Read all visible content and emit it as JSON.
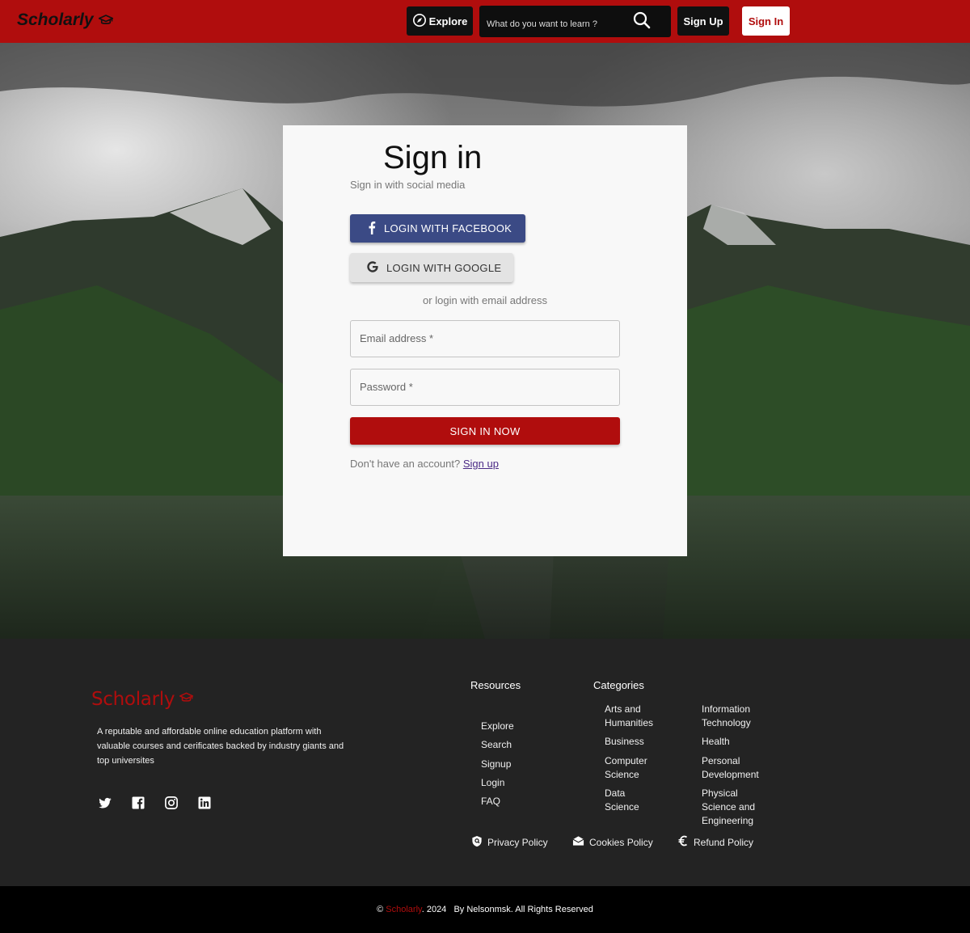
{
  "header": {
    "brand": "Scholarly",
    "explore_label": "Explore",
    "search_placeholder": "What do you want to learn ?",
    "signup_label": "Sign Up",
    "signin_label": "Sign In"
  },
  "signin_card": {
    "title": "Sign in",
    "subtitle": "Sign in with social media",
    "facebook_label": "LOGIN WITH FACEBOOK",
    "google_label": "LOGIN WITH GOOGLE",
    "or_text": "or login with email address",
    "email_label": "Email address *",
    "password_label": "Password *",
    "submit_label": "SIGN IN NOW",
    "no_account_text": "Don't have an account?",
    "signup_link": "Sign up"
  },
  "footer": {
    "brand": "Scholarly",
    "description": "A reputable and affordable online education platform with valuable courses and cerificates backed by industry giants and top universites",
    "social_icons": [
      "twitter-icon",
      "facebook-icon",
      "instagram-icon",
      "linkedin-icon"
    ],
    "resources_heading": "Resources",
    "resources": [
      "Explore",
      "Search",
      "Signup",
      "Login",
      "FAQ"
    ],
    "categories_heading": "Categories",
    "categories_col1": [
      "Arts and Humanities",
      "Business",
      "Computer Science",
      "Data Science"
    ],
    "categories_col2": [
      "Information Technology",
      "Health",
      "Personal Development",
      "Physical Science and Engineering"
    ],
    "policies": [
      "Privacy Policy",
      "Cookies Policy",
      "Refund Policy"
    ]
  },
  "copyright": {
    "symbol": "©",
    "brand": "Scholarly",
    "rest": ". 2024   By Nelsonmsk. All Rights Reserved"
  },
  "colors": {
    "brand_red": "#b00d0d",
    "facebook_blue": "#3b4a85",
    "footer_bg": "#232323"
  }
}
